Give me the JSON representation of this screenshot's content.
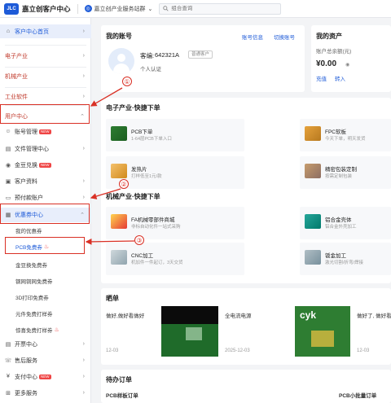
{
  "header": {
    "logo_text": "JLC",
    "brand": "嘉立创客户中心",
    "platform": "嘉立创产业服务站群",
    "search_placeholder": "组合查询"
  },
  "sidebar": {
    "home": "客户中心首页",
    "groups": [
      {
        "label": "电子产业"
      },
      {
        "label": "机械产业"
      },
      {
        "label": "工业软件"
      },
      {
        "label": "用户中心"
      }
    ],
    "user_items": [
      {
        "label": "账号管理",
        "badge": "NEW"
      },
      {
        "label": "文件管理中心"
      },
      {
        "label": "金豆兑换",
        "badge": "NEW"
      },
      {
        "label": "客户资料"
      },
      {
        "label": "预付款账户"
      }
    ],
    "coupon_center": "优惠券中心",
    "coupon_items": [
      {
        "label": "我的优惠券"
      },
      {
        "label": "PCB免费券"
      },
      {
        "label": "金豆换免费券"
      },
      {
        "label": "钢网铜网免费券"
      },
      {
        "label": "3D打印免费券"
      },
      {
        "label": "元件免费打样券"
      },
      {
        "label": "惊喜免费打样券"
      }
    ],
    "bottom_items": [
      {
        "label": "开票中心"
      },
      {
        "label": "售后服务"
      },
      {
        "label": "支付中心",
        "badge": "NEW"
      },
      {
        "label": "更多服务"
      }
    ]
  },
  "account": {
    "title": "我的账号",
    "link_info": "账号信息",
    "link_switch": "切换账号",
    "customer_label": "客编:",
    "customer_id": "642321A",
    "tag": "普通客户",
    "verify": "个人认证"
  },
  "assets": {
    "title": "我的资产",
    "label": "账户总余额(元)",
    "amount": "¥0.00",
    "link_recharge": "充值",
    "link_transfer": "转入"
  },
  "electronic": {
    "title": "电子产业·快捷下单",
    "tiles": [
      {
        "name": "PCB下单",
        "desc": "1-64层PCB下单入口"
      },
      {
        "name": "FPC软板",
        "desc": "今天下单，明天发货"
      },
      {
        "name": "发热片",
        "desc": "打样低至1元/款"
      },
      {
        "name": "精密包装定制",
        "desc": "按需定制包装"
      }
    ]
  },
  "mechanical": {
    "title": "机械产业·快捷下单",
    "tiles": [
      {
        "name": "FA机械零部件商城",
        "desc": "非标自动化件一站式采购"
      },
      {
        "name": "铝合金壳体",
        "desc": "铝合金外壳加工"
      },
      {
        "name": "CNC加工",
        "desc": "机加件一件起订，3天交货"
      },
      {
        "name": "钣金加工",
        "desc": "激光切割/折弯/焊接"
      }
    ]
  },
  "orders": {
    "title": "晒单",
    "items": [
      {
        "text": "做好,做好看做好",
        "date": "12-03"
      },
      {
        "text": "全电流电源",
        "date": "2025-12-03"
      },
      {
        "text": "做好了, 做好看",
        "date": "12-03"
      }
    ]
  },
  "pending": {
    "title": "待办订单",
    "left": "PCB样板订单",
    "right": "PCB小批量订单"
  },
  "annotations": [
    "①",
    "②",
    "③"
  ],
  "colors": {
    "accent": "#1e5bd8",
    "annotation": "#d93025",
    "hot": "#ef4444"
  }
}
